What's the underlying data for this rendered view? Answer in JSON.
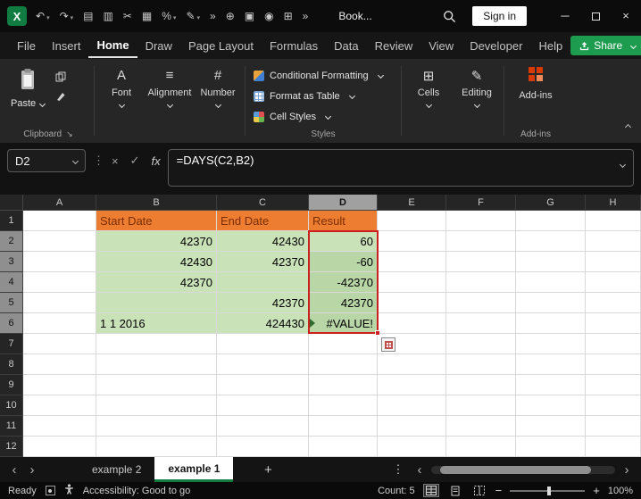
{
  "colors": {
    "accent_green": "#107C41",
    "share_button": "#1d9c4f",
    "header_fill": "#ED7D31",
    "data_fill": "#C9E2B8",
    "selection_fill": "#B9D6A6",
    "selection_border": "#CC2020",
    "addins_icon": "#D83B01"
  },
  "titlebar": {
    "document_title": "Book...",
    "sign_in_label": "Sign in",
    "quick_access_icons": [
      {
        "name": "undo-icon",
        "glyph": "↶",
        "dropdown": true
      },
      {
        "name": "redo-icon",
        "glyph": "↷",
        "dropdown": true
      },
      {
        "name": "new-file-icon",
        "glyph": "▤",
        "dropdown": false
      },
      {
        "name": "copy-icon",
        "glyph": "▥",
        "dropdown": false
      },
      {
        "name": "cut-icon",
        "glyph": "✂",
        "dropdown": false
      },
      {
        "name": "paste-icon",
        "glyph": "▦",
        "dropdown": false
      },
      {
        "name": "percent-style-icon",
        "glyph": "%",
        "dropdown": true
      },
      {
        "name": "format-painter-icon",
        "glyph": "✎",
        "dropdown": true
      },
      {
        "name": "qat-overflow-icon",
        "glyph": "»",
        "dropdown": false
      },
      {
        "name": "move-tool-icon",
        "glyph": "⊕",
        "dropdown": false
      },
      {
        "name": "save-icon",
        "glyph": "▣",
        "dropdown": false
      },
      {
        "name": "camera-icon",
        "glyph": "◉",
        "dropdown": false
      },
      {
        "name": "table-icon",
        "glyph": "⊞",
        "dropdown": false
      },
      {
        "name": "more-commands-icon",
        "glyph": "»",
        "dropdown": false
      }
    ],
    "window_controls": {
      "minimize": "─",
      "close": "×"
    }
  },
  "menubar": {
    "tabs": [
      {
        "label": "File",
        "active": false
      },
      {
        "label": "Insert",
        "active": false
      },
      {
        "label": "Home",
        "active": true
      },
      {
        "label": "Draw",
        "active": false
      },
      {
        "label": "Page Layout",
        "active": false
      },
      {
        "label": "Formulas",
        "active": false
      },
      {
        "label": "Data",
        "active": false
      },
      {
        "label": "Review",
        "active": false
      },
      {
        "label": "View",
        "active": false
      },
      {
        "label": "Developer",
        "active": false
      },
      {
        "label": "Help",
        "active": false
      }
    ],
    "share_label": "Share"
  },
  "ribbon": {
    "paste": {
      "label": "Paste"
    },
    "clipboard_group": "Clipboard",
    "collapsed_groups": [
      {
        "label": "Font"
      },
      {
        "label": "Alignment"
      },
      {
        "label": "Number"
      }
    ],
    "styles_group": {
      "items": [
        "Conditional Formatting",
        "Format as Table",
        "Cell Styles"
      ],
      "label": "Styles"
    },
    "right_collapsed_groups": [
      {
        "label": "Cells"
      },
      {
        "label": "Editing"
      }
    ],
    "addins": {
      "button_label": "Add-ins",
      "group_label": "Add-ins"
    }
  },
  "formula_bar": {
    "name_box_value": "D2",
    "formula": "=DAYS(C2,B2)"
  },
  "sheet": {
    "column_headers": [
      "A",
      "B",
      "C",
      "D",
      "E",
      "F",
      "G",
      "H"
    ],
    "visible_rows": 12,
    "selected_column": "D",
    "selected_rows": [
      2,
      3,
      4,
      5,
      6
    ],
    "active_cell": "D2",
    "cells": [
      {
        "row": 1,
        "col": "B",
        "value": "Start Date",
        "fill": "orange",
        "align": "left"
      },
      {
        "row": 1,
        "col": "C",
        "value": "End Date",
        "fill": "orange",
        "align": "left"
      },
      {
        "row": 1,
        "col": "D",
        "value": "Result",
        "fill": "orange",
        "align": "left"
      },
      {
        "row": 2,
        "col": "B",
        "value": "42370",
        "fill": "green",
        "align": "right"
      },
      {
        "row": 2,
        "col": "C",
        "value": "42430",
        "fill": "green",
        "align": "right"
      },
      {
        "row": 2,
        "col": "D",
        "value": "60",
        "fill": "selection",
        "align": "right"
      },
      {
        "row": 3,
        "col": "B",
        "value": "42430",
        "fill": "green",
        "align": "right"
      },
      {
        "row": 3,
        "col": "C",
        "value": "42370",
        "fill": "green",
        "align": "right"
      },
      {
        "row": 3,
        "col": "D",
        "value": "-60",
        "fill": "selection",
        "align": "right"
      },
      {
        "row": 4,
        "col": "B",
        "value": "42370",
        "fill": "green",
        "align": "right"
      },
      {
        "row": 4,
        "col": "C",
        "value": "",
        "fill": "green",
        "align": "right"
      },
      {
        "row": 4,
        "col": "D",
        "value": "-42370",
        "fill": "selection",
        "align": "right"
      },
      {
        "row": 5,
        "col": "B",
        "value": "",
        "fill": "green",
        "align": "right"
      },
      {
        "row": 5,
        "col": "C",
        "value": "42370",
        "fill": "green",
        "align": "right"
      },
      {
        "row": 5,
        "col": "D",
        "value": "42370",
        "fill": "selection",
        "align": "right"
      },
      {
        "row": 6,
        "col": "B",
        "value": "1 1 2016",
        "fill": "green",
        "align": "left"
      },
      {
        "row": 6,
        "col": "C",
        "value": "424430",
        "fill": "green",
        "align": "right"
      },
      {
        "row": 6,
        "col": "D",
        "value": "#VALUE!",
        "fill": "selection",
        "align": "right",
        "error": true
      }
    ]
  },
  "sheet_tabs": {
    "tabs": [
      {
        "label": "example 2",
        "active": false
      },
      {
        "label": "example 1",
        "active": true
      }
    ]
  },
  "status_bar": {
    "mode": "Ready",
    "accessibility": "Accessibility: Good to go",
    "count": "Count: 5",
    "zoom": "100%"
  }
}
